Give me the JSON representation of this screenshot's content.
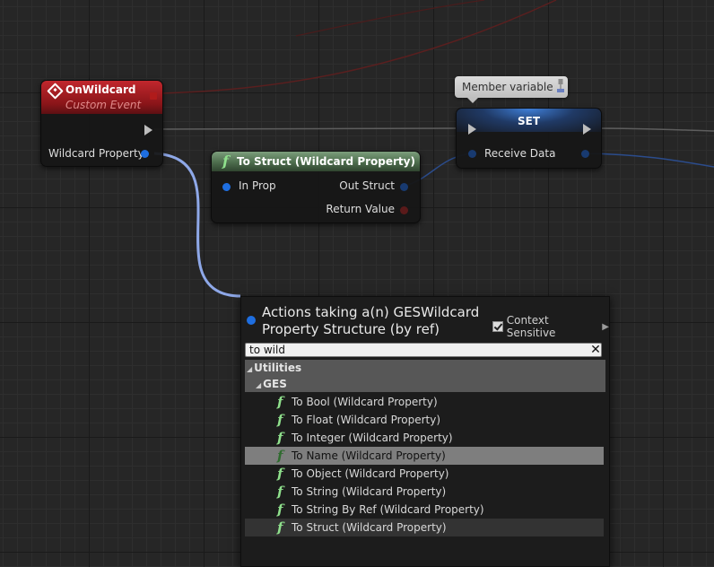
{
  "nodes": {
    "on_wildcard": {
      "title": "OnWildcard",
      "subtitle": "Custom Event",
      "pin_label": "Wildcard Property"
    },
    "to_struct": {
      "title": "To Struct (Wildcard Property)",
      "in_pin": "In Prop",
      "out_pin": "Out Struct",
      "return_pin": "Return Value"
    },
    "set": {
      "title": "SET",
      "pin_label": "Receive Data",
      "tooltip": "Member variable"
    }
  },
  "menu": {
    "title": "Actions taking a(n) GESWildcard Property Structure (by ref)",
    "context_sensitive": "Context Sensitive",
    "search_value": "to wild",
    "category": "Utilities",
    "subcategory": "GES",
    "items": [
      "To Bool (Wildcard Property)",
      "To Float (Wildcard Property)",
      "To Integer (Wildcard Property)",
      "To Name (Wildcard Property)",
      "To Object (Wildcard Property)",
      "To String (Wildcard Property)",
      "To String By Ref (Wildcard Property)",
      "To Struct (Wildcard Property)"
    ],
    "selected_item": "To Name (Wildcard Property)",
    "hovered_item": "To Struct (Wildcard Property)"
  },
  "icons": {
    "event": "custom-event-icon",
    "function": "function-icon",
    "exec": "exec-pin-icon",
    "clear": "clear-icon",
    "checkbox": "checkbox-icon",
    "pin": "pin-icon"
  },
  "colors": {
    "event_header": "#c1272d",
    "function_header": "#4d6d4d",
    "set_header": "#3f7fd8",
    "struct_pin": "#1e6ee0",
    "wire_struct": "#8ea8e8",
    "selected_row": "#7e7e7e"
  }
}
